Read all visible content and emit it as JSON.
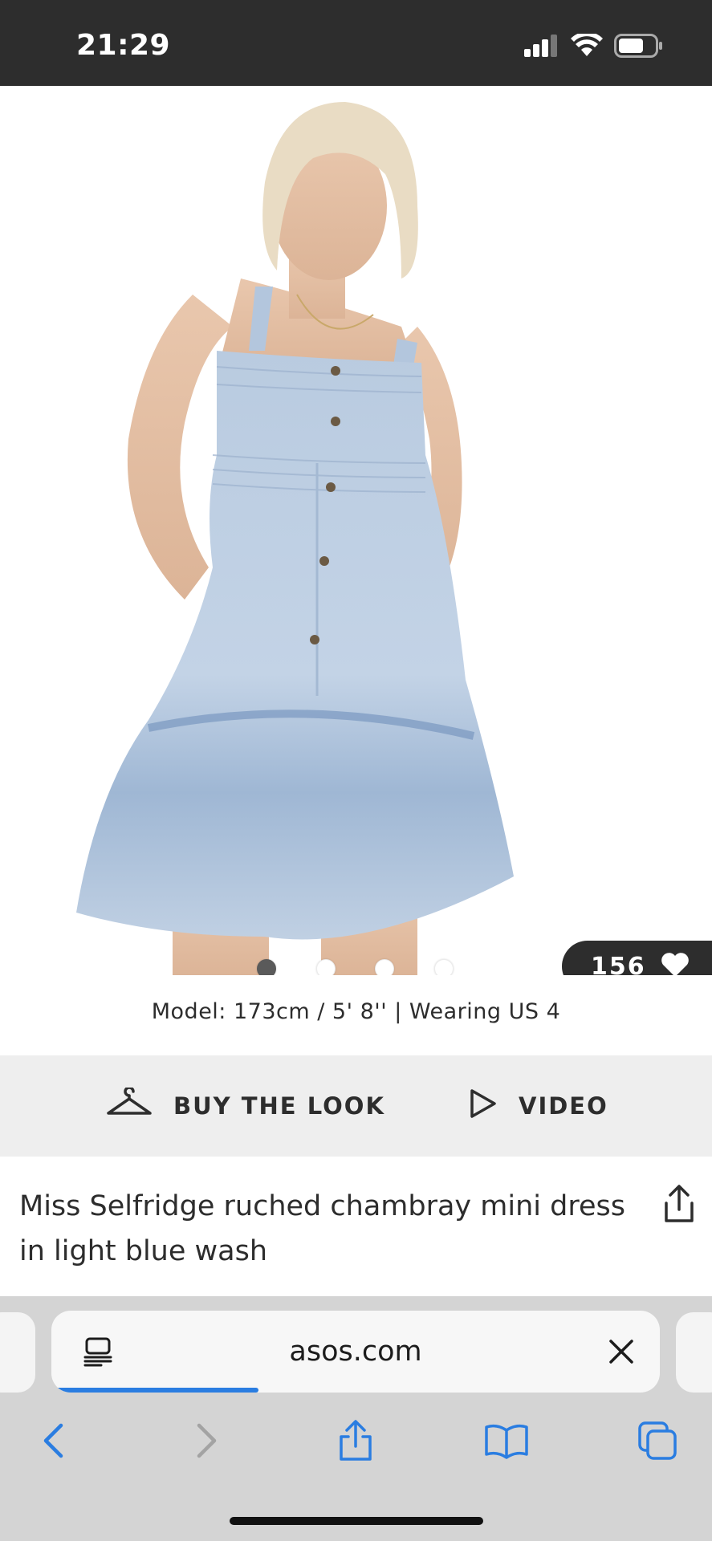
{
  "status_bar": {
    "time": "21:29",
    "icons": [
      "cellular-signal-icon",
      "wifi-icon",
      "battery-icon"
    ]
  },
  "product": {
    "image_count": 4,
    "active_image": 1,
    "likes": "156",
    "model_info": "Model: 173cm / 5' 8'' | Wearing US 4",
    "title": "Miss Selfridge ruched chambray mini dress in light blue wash"
  },
  "actions": {
    "buy_the_look": "BUY THE LOOK",
    "video": "VIDEO"
  },
  "browser": {
    "url": "asos.com",
    "load_progress": 0.34,
    "toolbar": [
      "back-icon",
      "forward-icon",
      "share-icon",
      "bookmarks-icon",
      "tabs-icon"
    ]
  },
  "colors": {
    "dark": "#2d2d2d",
    "strip_bg": "#eeeeee",
    "safari_blue": "#2a7de1",
    "browser_bg": "#d4d4d4"
  }
}
